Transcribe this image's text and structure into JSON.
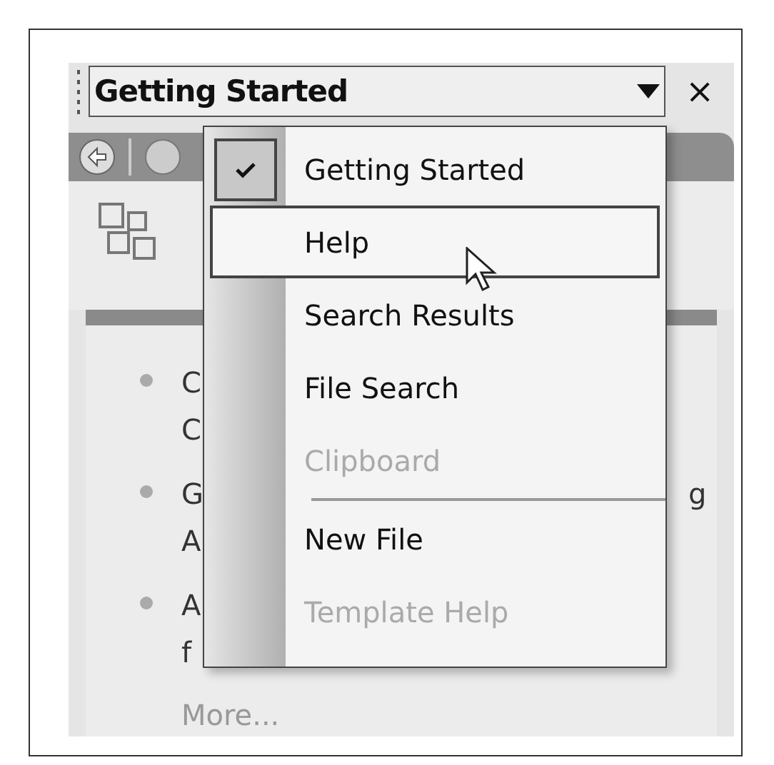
{
  "pane": {
    "title": "Getting Started",
    "close": "×"
  },
  "menu": [
    {
      "label": "Getting Started",
      "checked": true,
      "selected": false,
      "disabled": false,
      "kind": "item"
    },
    {
      "label": "Help",
      "checked": false,
      "selected": true,
      "disabled": false,
      "kind": "item"
    },
    {
      "label": "Search Results",
      "checked": false,
      "selected": false,
      "disabled": false,
      "kind": "item"
    },
    {
      "label": "File Search",
      "checked": false,
      "selected": false,
      "disabled": false,
      "kind": "item"
    },
    {
      "label": "Clipboard",
      "checked": false,
      "selected": false,
      "disabled": true,
      "kind": "item"
    },
    {
      "kind": "separator"
    },
    {
      "label": "New File",
      "checked": false,
      "selected": false,
      "disabled": false,
      "kind": "item"
    },
    {
      "label": "Template Help",
      "checked": false,
      "selected": false,
      "disabled": true,
      "kind": "item"
    }
  ],
  "links": [
    {
      "lines": [
        "C",
        "C"
      ]
    },
    {
      "lines": [
        "G",
        "A"
      ],
      "tail": "g"
    },
    {
      "lines": [
        "A",
        "f"
      ]
    }
  ],
  "more": "More..."
}
